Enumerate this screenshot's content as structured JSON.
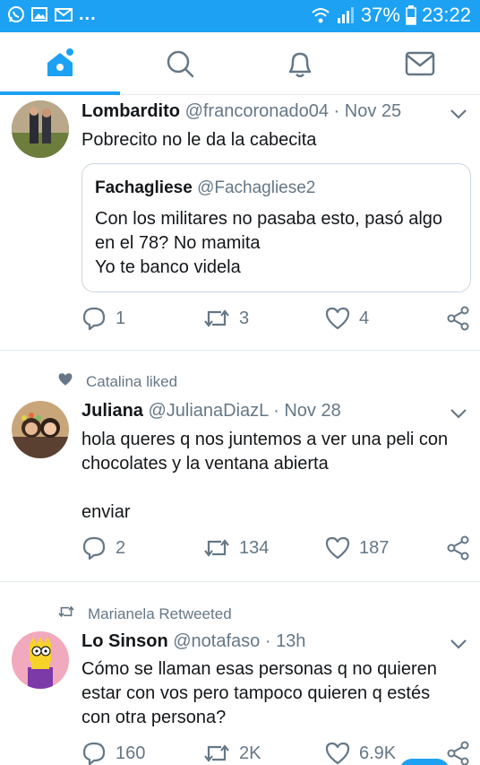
{
  "status_bar": {
    "notification_icons": [
      "whatsapp-icon",
      "gallery-icon",
      "mail-icon"
    ],
    "more": "...",
    "battery": "37%",
    "time": "23:22"
  },
  "tabs": [
    {
      "name": "home-icon",
      "active": true
    },
    {
      "name": "search-icon",
      "active": false
    },
    {
      "name": "bell-icon",
      "active": false
    },
    {
      "name": "messages-icon",
      "active": false
    }
  ],
  "colors": {
    "accent": "#1da1f2",
    "text": "#14171a",
    "muted": "#657786",
    "border": "#e1e8ed"
  },
  "tweets": [
    {
      "name": "Lombardito",
      "handle": "@francoronado04",
      "separator": "·",
      "date": "Nov 25",
      "text": "Pobrecito no le da la cabecita",
      "quote": {
        "name": "Fachagliese",
        "handle": "@Fachagliese2",
        "lines": [
          "Con los militares no pasaba esto, pasó algo",
          "en el 78? No mamita",
          "Yo te banco videla"
        ]
      },
      "replies": "1",
      "retweets": "3",
      "likes": "4"
    },
    {
      "context": "Catalina liked",
      "name": "Juliana",
      "handle": "@JulianaDiazL",
      "separator": "·",
      "date": "Nov 28",
      "lines": [
        "hola queres q nos juntemos a ver una peli con",
        "chocolates y la ventana abierta",
        "",
        "enviar"
      ],
      "replies": "2",
      "retweets": "134",
      "likes": "187"
    },
    {
      "context": "Marianela Retweeted",
      "name": "Lo Sinson",
      "handle": "@notafaso",
      "separator": "·",
      "date": "13h",
      "lines": [
        "Cómo se llaman esas personas q no quieren",
        "estar con vos pero tampoco quieren q estés",
        "con otra persona?"
      ],
      "replies": "160",
      "retweets": "2K",
      "likes": "6.9K"
    }
  ]
}
